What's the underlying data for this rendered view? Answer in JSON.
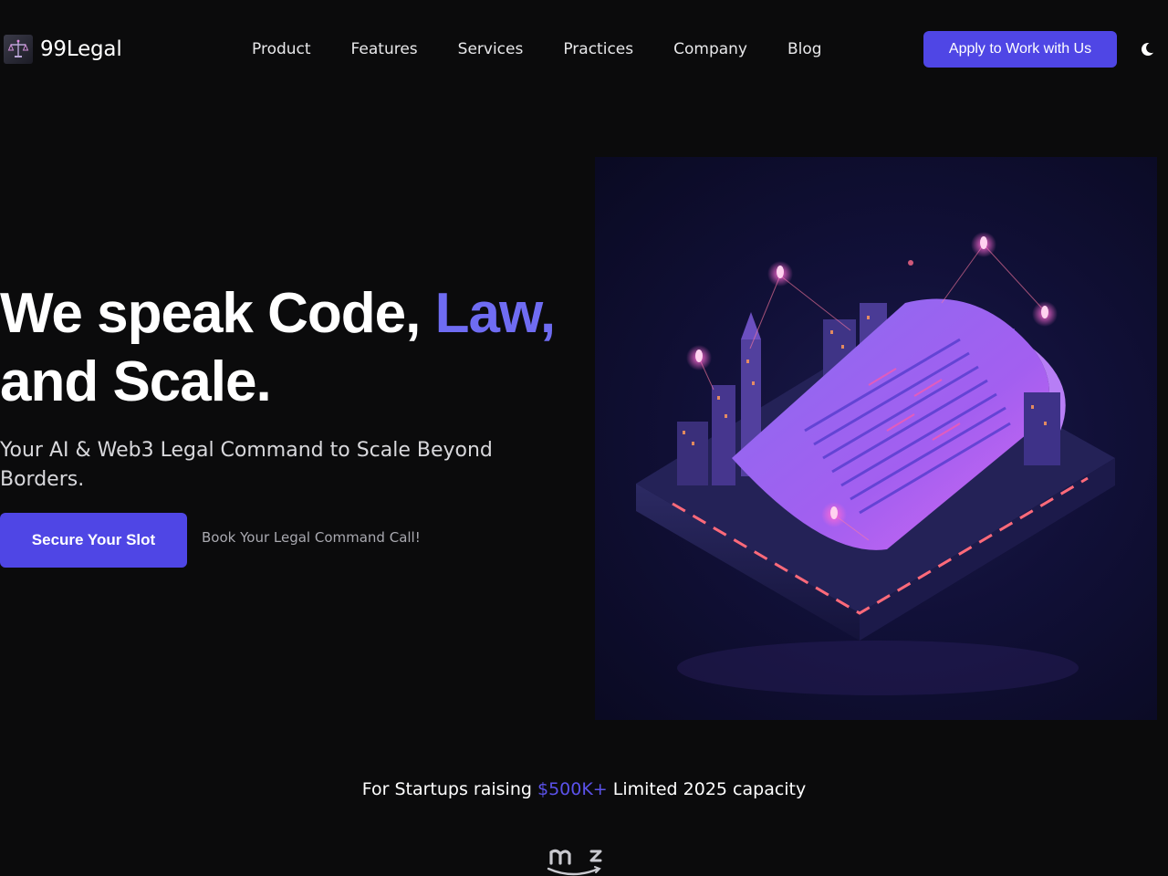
{
  "brand": {
    "name": "99Legal",
    "logo_icon": "scales-of-justice-icon"
  },
  "nav": {
    "items": [
      {
        "label": "Product"
      },
      {
        "label": "Features"
      },
      {
        "label": "Services"
      },
      {
        "label": "Practices"
      },
      {
        "label": "Company"
      },
      {
        "label": "Blog"
      }
    ]
  },
  "header": {
    "apply_label": "Apply to Work with Us",
    "theme_icon": "moon-icon"
  },
  "hero": {
    "title_part1": "We speak Code, ",
    "title_accent": "Law,",
    "title_part2": "and Scale.",
    "subtitle": "Your AI & Web3 Legal Command to Scale Beyond Borders.",
    "cta_label": "Secure Your Slot",
    "cta_note": "Book Your Legal Command Call!",
    "image_subject": "isometric-legal-document-city-illustration"
  },
  "capacity": {
    "prefix": "For Startups raising ",
    "highlight": "$500K+",
    "suffix": " Limited 2025 capacity"
  },
  "colors": {
    "background": "#0b0b0c",
    "primary_button": "#4f46e5",
    "title_accent": "#6f6cf2",
    "highlight": "#5b52ea"
  }
}
